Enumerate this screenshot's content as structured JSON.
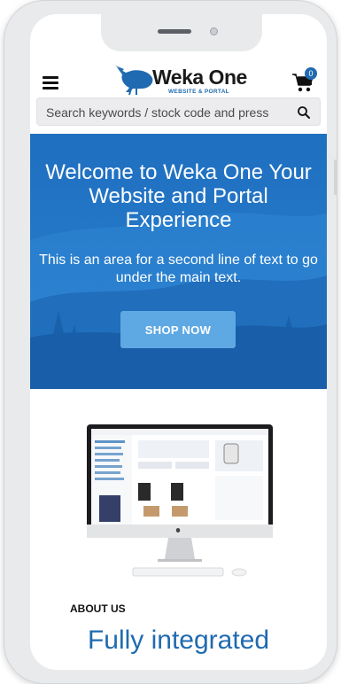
{
  "header": {
    "logo_text": "Weka One",
    "logo_subtitle": "WEBSITE & PORTAL",
    "cart_count": "0"
  },
  "search": {
    "placeholder": "Search keywords / stock code and press"
  },
  "hero": {
    "title": "Welcome to Weka One Your Website and Portal Experience",
    "subtitle": "This is an area for a second line of text to go under the main text.",
    "button_label": "SHOP NOW"
  },
  "about": {
    "label": "ABOUT US",
    "headline": "Fully integrated"
  },
  "colors": {
    "brand_blue": "#1f6ab0",
    "hero_bg": "#2a7bc9",
    "button_bg": "#5ea8e4"
  }
}
